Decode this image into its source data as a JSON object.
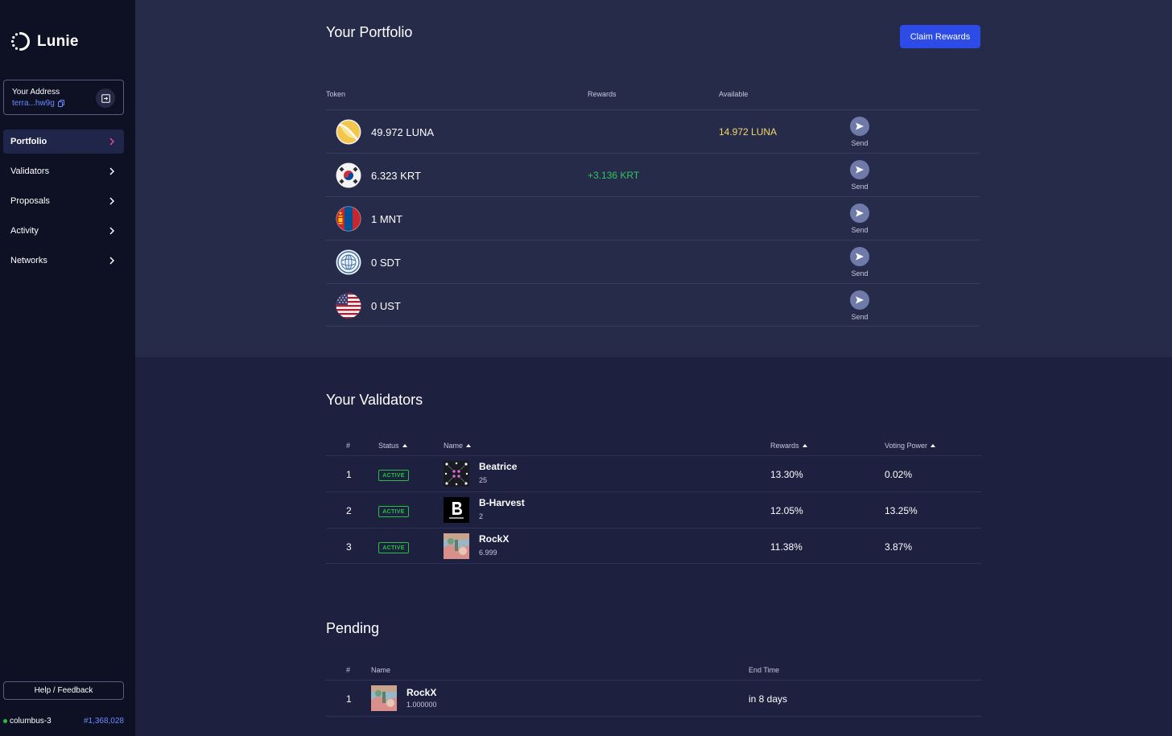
{
  "app": {
    "name": "Lunie"
  },
  "sidebar": {
    "address_label": "Your Address",
    "address_value": "terra...hw9g",
    "nav": [
      {
        "label": "Portfolio",
        "active": true
      },
      {
        "label": "Validators",
        "active": false
      },
      {
        "label": "Proposals",
        "active": false
      },
      {
        "label": "Activity",
        "active": false
      },
      {
        "label": "Networks",
        "active": false
      }
    ],
    "help_label": "Help / Feedback",
    "network": "columbus-3",
    "block": "#1,368,028"
  },
  "portfolio": {
    "title": "Your Portfolio",
    "claim_label": "Claim Rewards",
    "columns": {
      "token": "Token",
      "rewards": "Rewards",
      "available": "Available"
    },
    "tokens": [
      {
        "amount": "49.972 LUNA",
        "rewards": "",
        "available": "14.972 LUNA",
        "icon": "luna-icon"
      },
      {
        "amount": "6.323 KRT",
        "rewards": "+3.136 KRT",
        "available": "",
        "icon": "korea-flag-icon"
      },
      {
        "amount": "1 MNT",
        "rewards": "",
        "available": "",
        "icon": "mongolia-flag-icon"
      },
      {
        "amount": "0 SDT",
        "rewards": "",
        "available": "",
        "icon": "imf-seal-icon"
      },
      {
        "amount": "0 UST",
        "rewards": "",
        "available": "",
        "icon": "usa-flag-icon"
      }
    ],
    "send_label": "Send"
  },
  "validators": {
    "title": "Your Validators",
    "columns": {
      "rank": "#",
      "status": "Status",
      "name": "Name",
      "rewards": "Rewards",
      "power": "Voting Power"
    },
    "rows": [
      {
        "rank": "1",
        "status": "ACTIVE",
        "name": "Beatrice",
        "sub": "25",
        "rewards": "13.30%",
        "power": "0.02%"
      },
      {
        "rank": "2",
        "status": "ACTIVE",
        "name": "B-Harvest",
        "sub": "2",
        "rewards": "12.05%",
        "power": "13.25%"
      },
      {
        "rank": "3",
        "status": "ACTIVE",
        "name": "RockX",
        "sub": "6.999",
        "rewards": "11.38%",
        "power": "3.87%"
      }
    ]
  },
  "pending": {
    "title": "Pending",
    "columns": {
      "rank": "#",
      "name": "Name",
      "end": "End Time"
    },
    "rows": [
      {
        "rank": "1",
        "name": "RockX",
        "sub": "1.000000",
        "end": "in 8 days"
      }
    ]
  },
  "colors": {
    "accent": "#2d4be6",
    "positive": "#2ec75f",
    "available": "#f3d66a",
    "link": "#6a8cff",
    "active": "#25c13f"
  }
}
